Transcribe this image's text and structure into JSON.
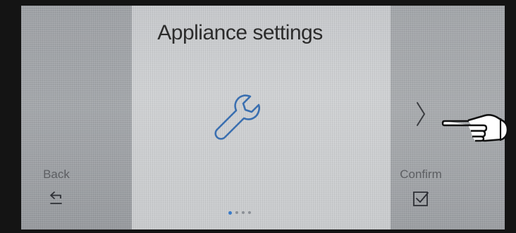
{
  "screen": {
    "title": "Appliance settings",
    "center_icon": "wrench-icon",
    "next_icon": "chevron-right-icon",
    "back": {
      "label": "Back",
      "icon": "back-arrow-icon"
    },
    "confirm": {
      "label": "Confirm",
      "icon": "checkbox-check-icon"
    },
    "pagination": {
      "total": 4,
      "current": 1
    }
  },
  "colors": {
    "icon_blue": "#3a6fb0",
    "title_text": "#2c2c2c",
    "label_text": "#5c5e62",
    "dot_active": "#3a7bc8"
  }
}
